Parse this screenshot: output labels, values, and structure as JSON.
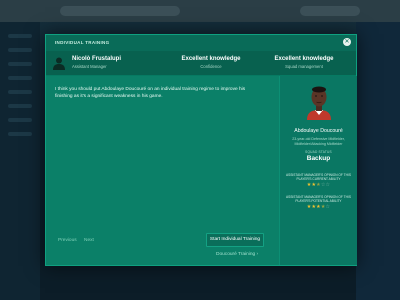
{
  "modal": {
    "title": "INDIVIDUAL TRAINING",
    "close_glyph": "✕"
  },
  "info": {
    "person_name": "Nicolò Frustalupi",
    "person_role": "Assistant Manager",
    "knowledge1": "Excellent knowledge",
    "knowledge1_sub": "Confidence",
    "knowledge2": "Excellent knowledge",
    "knowledge2_sub": "Squad management"
  },
  "message": "I think you should put Abdoulaye Doucouré on an individual training regime to improve his finishing as it's a significant weakness in his game.",
  "nav": {
    "prev": "Previous",
    "next": "Next"
  },
  "actions": {
    "start_training": "Start Individual Training",
    "link": "Doucouré Training ›"
  },
  "player": {
    "name": "Abdoulaye Doucouré",
    "line1": "23-year-old Defensive Midfielder,",
    "line2": "Midfielder/Attacking Midfielder",
    "squad_status_label": "SQUAD STATUS",
    "squad_status": "Backup",
    "opinion_current_label": "ASSISTANT MANAGER'S OPINION OF THIS PLAYER'S CURRENT ABILITY",
    "opinion_current_stars": 2.5,
    "opinion_potential_label": "ASSISTANT MANAGER'S OPINION OF THIS PLAYER'S POTENTIAL ABILITY",
    "opinion_potential_stars": 3.5
  },
  "colors": {
    "modal_bg": "#0a7d67",
    "accent_star": "#f2c230"
  }
}
